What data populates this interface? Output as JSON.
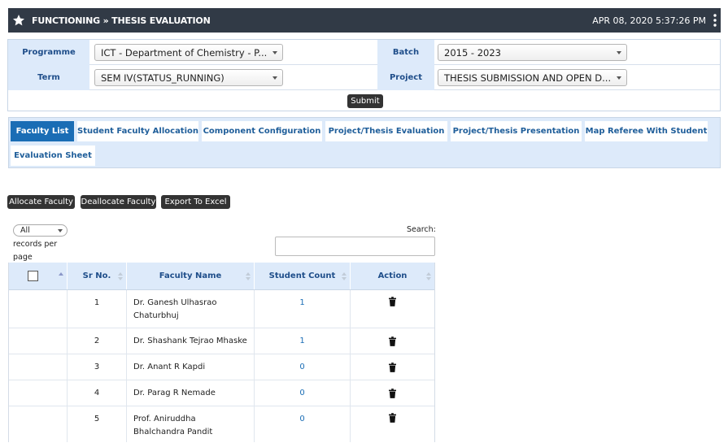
{
  "header": {
    "title": "FUNCTIONING » THESIS EVALUATION",
    "datetime": "APR 08, 2020   5:37:26 PM"
  },
  "filters": {
    "programme_label": "Programme",
    "programme_value": "ICT - Department of Chemistry - P...",
    "batch_label": "Batch",
    "batch_value": "2015 - 2023",
    "term_label": "Term",
    "term_value": "SEM IV(STATUS_RUNNING)",
    "project_label": "Project",
    "project_value": "THESIS SUBMISSION AND OPEN D...",
    "submit_label": "Submit"
  },
  "tabs": [
    {
      "label": "Faculty List",
      "active": true
    },
    {
      "label": "Student Faculty Allocation"
    },
    {
      "label": "Component Configuration"
    },
    {
      "label": "Project/Thesis Evaluation"
    },
    {
      "label": "Project/Thesis Presentation"
    },
    {
      "label": "Map Referee With Student"
    },
    {
      "label": "Evaluation Sheet"
    }
  ],
  "actions": {
    "allocate": "Allocate Faculty",
    "deallocate": "Deallocate Faculty",
    "export": "Export To Excel"
  },
  "table_controls": {
    "records_value": "All",
    "records_label": "records per page",
    "search_label": "Search:",
    "search_value": ""
  },
  "table": {
    "columns": [
      "",
      "Sr No.",
      "Faculty Name",
      "Student Count",
      "Action"
    ],
    "rows": [
      {
        "sr": "1",
        "name": "Dr. Ganesh Ulhasrao Chaturbhuj",
        "count": "1"
      },
      {
        "sr": "2",
        "name": "Dr. Shashank Tejrao Mhaske",
        "count": "1"
      },
      {
        "sr": "3",
        "name": "Dr. Anant R Kapdi",
        "count": "0"
      },
      {
        "sr": "4",
        "name": "Dr. Parag R Nemade",
        "count": "0"
      },
      {
        "sr": "5",
        "name": "Prof. Aniruddha Bhalchandra Pandit",
        "count": "0"
      }
    ]
  },
  "colors": {
    "titlebar": "#313a46",
    "accent": "#1a6db5",
    "label_bg": "#ddeafa"
  },
  "icons": {
    "title": "star-icon",
    "menu": "kebab-menu-icon",
    "action": "trash-icon"
  }
}
